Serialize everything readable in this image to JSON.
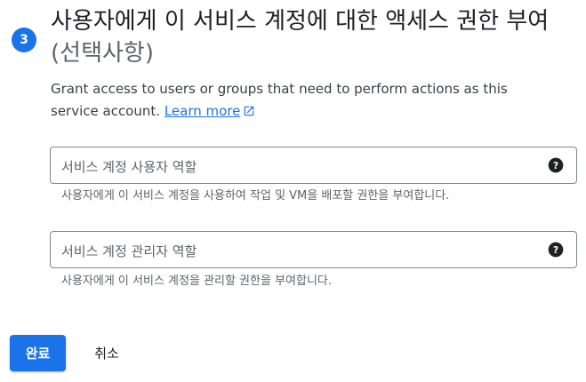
{
  "step": {
    "number": "3"
  },
  "section": {
    "title": "사용자에게 이 서비스 계정에 대한 액세스 권한 부여",
    "optional": "(선택사항)",
    "description": "Grant access to users or groups that need to perform actions as this service account.",
    "learn_more": "Learn more"
  },
  "fields": {
    "user_role": {
      "label": "서비스 계정 사용자 역할",
      "hint": "사용자에게 이 서비스 계정을 사용하여 작업 및 VM을 배포할 권한을 부여합니다."
    },
    "admin_role": {
      "label": "서비스 계정 관리자 역할",
      "hint": "사용자에게 이 서비스 계정을 관리할 권한을 부여합니다."
    }
  },
  "actions": {
    "done": "완료",
    "cancel": "취소"
  },
  "colors": {
    "accent": "#1a73e8",
    "text": "#202124",
    "muted": "#5f6368"
  }
}
